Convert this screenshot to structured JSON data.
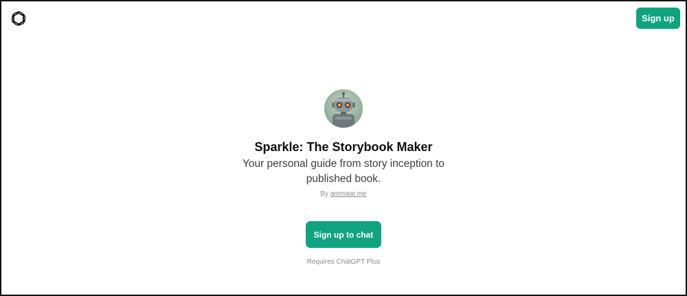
{
  "header": {
    "logo_icon": "openai-logo-icon",
    "signup_label": "Sign up"
  },
  "gpt": {
    "avatar_icon": "robot-avatar",
    "title": "Sparkle: The Storybook Maker",
    "description": "Your personal guide from story inception to published book.",
    "by_prefix": "By",
    "author": "ammaar.me"
  },
  "cta": {
    "label": "Sign up to chat",
    "requirement": "Requires ChatGPT Plus"
  },
  "colors": {
    "accent": "#10a37f",
    "text": "#0d0d0d",
    "muted": "#8a8a8a"
  }
}
